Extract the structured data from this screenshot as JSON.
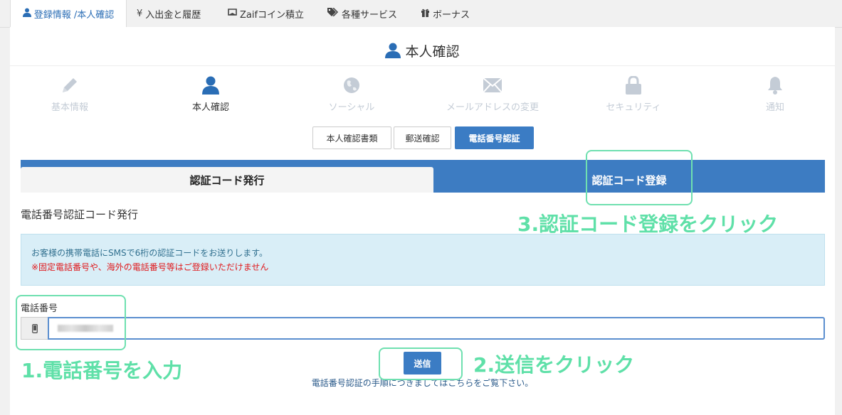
{
  "top_tabs": [
    {
      "label": "登録情報 /本人確認",
      "icon": "user-icon"
    },
    {
      "label": "入出金と履歴",
      "icon": "yen-icon"
    },
    {
      "label": "Zaifコイン積立",
      "icon": "coin-icon"
    },
    {
      "label": "各種サービス",
      "icon": "tags-icon"
    },
    {
      "label": "ボーナス",
      "icon": "gift-icon"
    }
  ],
  "page_title": "本人確認",
  "steps": [
    {
      "label": "基本情報",
      "icon": "pencil-icon"
    },
    {
      "label": "本人確認",
      "icon": "user-icon"
    },
    {
      "label": "ソーシャル",
      "icon": "globe-icon"
    },
    {
      "label": "メールアドレスの変更",
      "icon": "envelope-icon"
    },
    {
      "label": "セキュリティ",
      "icon": "lock-icon"
    },
    {
      "label": "通知",
      "icon": "bell-icon"
    }
  ],
  "sub_buttons": [
    "本人確認書類",
    "郵送確認",
    "電話番号認証"
  ],
  "code_tabs": {
    "issue": "認証コード発行",
    "register": "認証コード登録"
  },
  "section_title": "電話番号認証コード発行",
  "alert": {
    "info": "お客様の携帯電話にSMSで6桁の認証コードをお送りします。",
    "warning": "※固定電話番号や、海外の電話番号等はご登録いただけません"
  },
  "phone_field": {
    "label": "電話番号",
    "icon": "mobile-phone-icon"
  },
  "send_label": "送信",
  "help_text": "電話番号認証の手順につきましてはこちらをご覧下さい。",
  "annotations": {
    "step1": "1.電話番号を入力",
    "step2": "2.送信をクリック",
    "step3": "3.認証コード登録をクリック"
  },
  "colors": {
    "accent": "#3b7cc4",
    "annotation": "#5fe0a8",
    "warning": "#e0191c"
  }
}
